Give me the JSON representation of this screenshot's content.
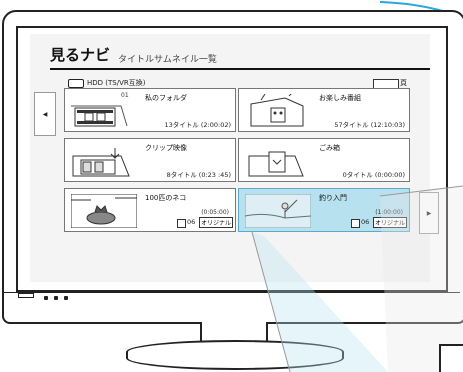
{
  "screen": {
    "title": "見るナビ",
    "subtitle": "タイトルサムネイル一覧",
    "source_label": "HDD (TS/VR互換)",
    "page_suffix": "頁"
  },
  "cards": [
    {
      "num": "01",
      "name": "私のフォルダ",
      "count": "13タイトル (2:00:02)",
      "icon": "folder-film-icon"
    },
    {
      "name": "お楽しみ番組",
      "count": "57タイトル (12:10:03)",
      "icon": "folder-robot-icon"
    },
    {
      "name": "クリップ映像",
      "count": "8タイトル (0:23 :45)",
      "icon": "clip-film-icon"
    },
    {
      "name": "ごみ箱",
      "count": "0タイトル (0:00:00)",
      "icon": "trash-folder-icon"
    },
    {
      "name": "100匹のネコ",
      "duration": "(0:05:00)",
      "index": "06",
      "tag": "オリジナル",
      "icon": "cat-thumbnail-icon"
    },
    {
      "name": "釣り入門",
      "duration": "(1:00:00)",
      "index": "06",
      "tag": "オリジナル",
      "icon": "fishing-thumbnail-icon",
      "selected": true
    }
  ],
  "colors": {
    "selected_bg": "#b8e1ef",
    "accent_line": "#2aa7d8"
  }
}
